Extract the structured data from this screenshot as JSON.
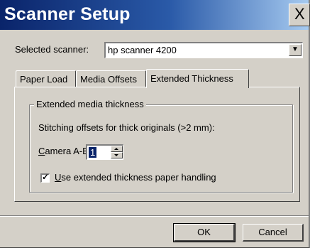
{
  "window": {
    "title": "Scanner Setup",
    "close_glyph": "X"
  },
  "scanner": {
    "label": "Selected scanner:",
    "selected_value": "hp scanner 4200",
    "dropdown_glyph": "▼"
  },
  "tabs": [
    {
      "label": "Paper Load",
      "active": false
    },
    {
      "label": "Media Offsets",
      "active": false
    },
    {
      "label": "Extended Thickness",
      "active": true
    }
  ],
  "extended": {
    "group_title": "Extended media thickness",
    "stitch_text": "Stitching offsets for thick originals (>2 mm):",
    "camera_label": "Camera A-B:",
    "camera_value": "1",
    "checkbox_label": "Use extended thickness paper handling",
    "checkbox_checked": true,
    "checkbox_glyph": "✓"
  },
  "buttons": {
    "ok": "OK",
    "cancel": "Cancel"
  }
}
